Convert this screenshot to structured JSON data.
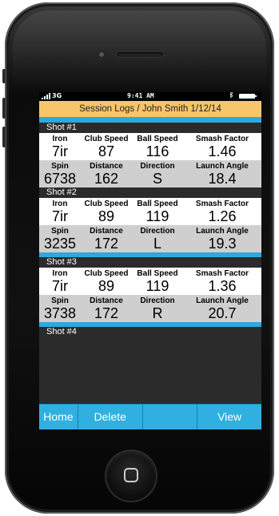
{
  "status_bar": {
    "carrier": "3G",
    "time": "9:41 AM",
    "bluetooth_icon": "bluetooth-icon",
    "battery_icon": "battery-icon"
  },
  "session": {
    "title": "Session Logs / John Smith  1/12/14"
  },
  "labels": {
    "iron": "Iron",
    "club_speed": "Club Speed",
    "ball_speed": "Ball Speed",
    "smash_factor": "Smash Factor",
    "spin": "Spin",
    "distance": "Distance",
    "direction": "Direction",
    "launch_angle": "Launch Angle"
  },
  "shots": [
    {
      "title": "Shot #1",
      "iron": "7ir",
      "club_speed": "87",
      "ball_speed": "116",
      "smash_factor": "1.46",
      "spin": "6738",
      "distance": "162",
      "direction": "S",
      "launch_angle": "18.4"
    },
    {
      "title": "Shot #2",
      "iron": "7ir",
      "club_speed": "89",
      "ball_speed": "119",
      "smash_factor": "1.26",
      "spin": "3235",
      "distance": "172",
      "direction": "L",
      "launch_angle": "19.3"
    },
    {
      "title": "Shot #3",
      "iron": "7ir",
      "club_speed": "89",
      "ball_speed": "119",
      "smash_factor": "1.36",
      "spin": "3738",
      "distance": "172",
      "direction": "R",
      "launch_angle": "20.7"
    },
    {
      "title": "Shot #4"
    }
  ],
  "toolbar": {
    "home": "Home",
    "delete": "Delete",
    "empty": "",
    "view": "View"
  },
  "colors": {
    "accent_blue": "#2da9dc",
    "session_bar": "#f7c56a",
    "shot_header": "#2b2b2b",
    "grey_row": "#cfcfcf"
  }
}
